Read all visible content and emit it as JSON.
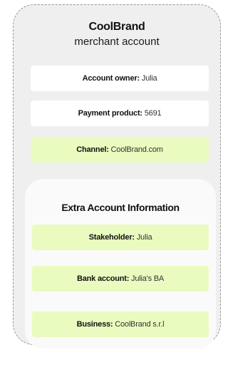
{
  "merchant": {
    "title": "CoolBrand",
    "subtitle": "merchant account",
    "fields": [
      {
        "label": "Account owner:",
        "value": "Julia"
      },
      {
        "label": "Payment product:",
        "value": "5691"
      },
      {
        "label": "Channel:",
        "value": "CoolBrand.com"
      }
    ]
  },
  "extra": {
    "title": "Extra Account Information",
    "fields": [
      {
        "label": "Stakeholder:",
        "value": "Julia"
      },
      {
        "label": "Bank account:",
        "value": "Julia's BA"
      },
      {
        "label": "Business:",
        "value": "CoolBrand s.r.l"
      }
    ]
  },
  "colors": {
    "outer_card": "#efefef",
    "inner_card": "#fafafa",
    "field_default": "#ffffff",
    "field_highlight": "#e9fbbf",
    "dashed_border": "#9a9a9a"
  }
}
